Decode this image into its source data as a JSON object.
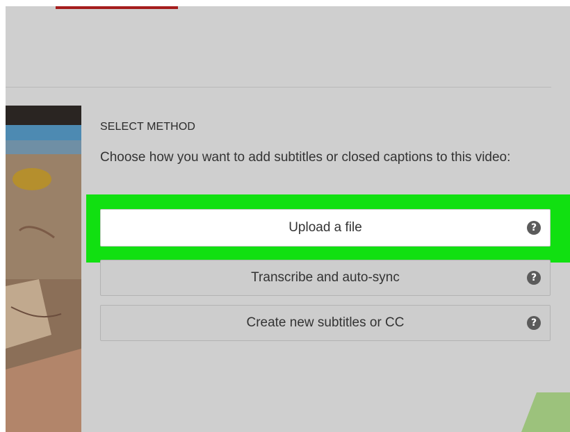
{
  "section_title": "SELECT METHOD",
  "description": "Choose how you want to add subtitles or closed captions to this video:",
  "methods": [
    {
      "label": "Upload a file",
      "help_icon": "?"
    },
    {
      "label": "Transcribe and auto-sync",
      "help_icon": "?"
    },
    {
      "label": "Create new subtitles or CC",
      "help_icon": "?"
    }
  ],
  "colors": {
    "highlight": "#11e011",
    "panel_background": "#cfcfcf",
    "active_tab": "#a51d1d",
    "help_icon": "#5b5b5b"
  },
  "icons": {
    "help": "question-circle-icon"
  }
}
